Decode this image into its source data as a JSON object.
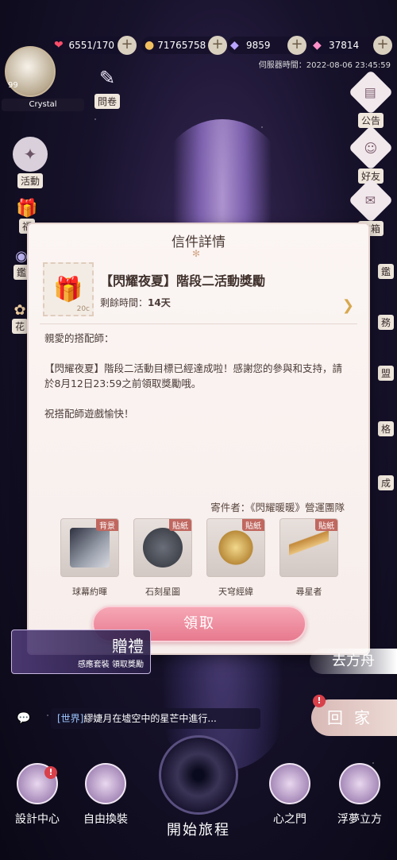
{
  "currency": {
    "stamina": "6551/170",
    "gold": "71765758",
    "diamond": "9859",
    "star_diamond": "37814"
  },
  "server_time": "伺服器時間：2022-08-06 23:45:59",
  "player": {
    "level": "99",
    "name": "Crystal"
  },
  "left_menu": {
    "questionnaire": "問卷",
    "event": "活動",
    "welfare": "福",
    "pavilion": "鑑",
    "flower": "花"
  },
  "right_menu": {
    "notice": "公告",
    "friends": "好友",
    "mail": "信箱",
    "collection": "鑑",
    "tasks": "務",
    "guild": "盟",
    "store": "格",
    "achievement": "成"
  },
  "modal": {
    "title": "信件詳情",
    "mail_title": "【閃耀夜夏】階段二活動獎勵",
    "remain_label": "剩餘時間：",
    "remain_value": "14天",
    "stamp_price": "20c",
    "greeting": "親愛的搭配師：",
    "body": "【閃耀夜夏】階段二活動目標已經達成啦！感謝您的參與和支持，請於8月12日23:59之前領取獎勵哦。",
    "closing": "祝搭配師遊戲愉快！",
    "sender": "寄件者：《閃耀暖暖》營運團隊",
    "rewards": [
      {
        "tag": "背景",
        "name": "球幕約暉"
      },
      {
        "tag": "貼紙",
        "name": "石刻星圖"
      },
      {
        "tag": "貼紙",
        "name": "天穹經緯"
      },
      {
        "tag": "貼紙",
        "name": "尋星者"
      }
    ],
    "claim_label": "領取"
  },
  "gift_banner": {
    "title": "贈禮",
    "subtitle": "感應套裝 領取獎勵"
  },
  "go_button": "去方舟",
  "chat": {
    "channel": "[世界]",
    "message": "繆婕月在墟空中的星芒中進行..."
  },
  "home_button": "回家",
  "bottom_nav": {
    "design_center": "設計中心",
    "free_change": "自由換裝",
    "start_journey": "開始旅程",
    "heart_gate": "心之門",
    "dream_cube": "浮夢立方"
  },
  "colors": {
    "claim_button": "#e7798e",
    "reward_tag": "#c0675f",
    "badge": "#d8404a"
  }
}
